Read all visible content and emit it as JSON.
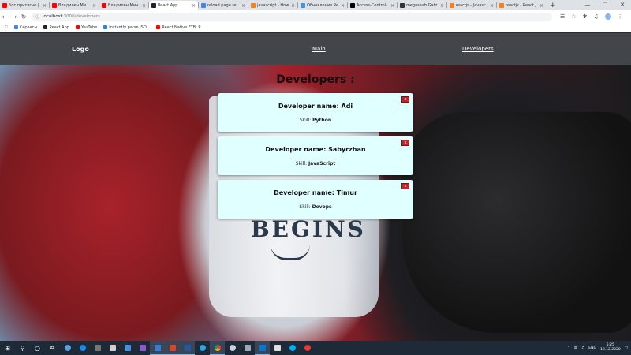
{
  "browser": {
    "tabs": [
      {
        "title": "Бог притягне | ...",
        "color": "#ff0000",
        "active": false
      },
      {
        "title": "Владилен Ми...",
        "color": "#ff0000",
        "active": false
      },
      {
        "title": "Владилен Мин...",
        "color": "#ff0000",
        "active": false
      },
      {
        "title": "React App",
        "color": "#20232a",
        "active": true
      },
      {
        "title": "reload page re...",
        "color": "#4285f4",
        "active": false
      },
      {
        "title": "javascript - How...",
        "color": "#f48024",
        "active": false
      },
      {
        "title": "Обновление Re...",
        "color": "#4a90e2",
        "active": false
      },
      {
        "title": "Access-Control-...",
        "color": "#000000",
        "active": false
      },
      {
        "title": "megasaab Gatz...",
        "color": "#333333",
        "active": false
      },
      {
        "title": "reactjs - Javasc...",
        "color": "#f48024",
        "active": false
      },
      {
        "title": "reactjs - React J...",
        "color": "#f48024",
        "active": false
      }
    ],
    "new_tab_label": "+",
    "url_host": "localhost",
    "url_path": ":3000/developers",
    "bookmarks": [
      {
        "label": "Сервисы",
        "color": "#4285f4"
      },
      {
        "label": "React App",
        "color": "#20232a"
      },
      {
        "label": "YouTube",
        "color": "#ff0000"
      },
      {
        "label": "Instantly parse JSO...",
        "color": "#1e88e5"
      },
      {
        "label": "React Native FTB: R...",
        "color": "#ff0000"
      }
    ]
  },
  "navbar": {
    "logo": "Logo",
    "links": [
      "Main",
      "Developers"
    ]
  },
  "page": {
    "heading": "Developers :",
    "delete_label": "x",
    "skill_label": "Skill:",
    "developers": [
      {
        "name": "Developer name: Adi",
        "skill": "Python"
      },
      {
        "name": "Developer name: Sabyrzhan",
        "skill": "JavaScript"
      },
      {
        "name": "Developer name: Timur",
        "skill": "Devops"
      }
    ]
  },
  "background": {
    "mug_text": "BEGINS"
  },
  "taskbar": {
    "language": "ENG",
    "time": "5:25",
    "date": "18.12.2020"
  }
}
